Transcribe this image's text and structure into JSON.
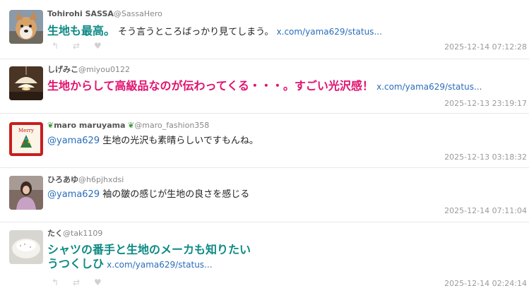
{
  "tweets": [
    {
      "name": "Tohirohi SASSA",
      "handle": "@SassaHero",
      "emph": "生地も最高。",
      "text": "そう言うところばっかり見てしまう。",
      "link": "x.com/yama629/status...",
      "time": "2025-12-14 07:12:28"
    },
    {
      "name": "しげみこ",
      "handle": "@miyou0122",
      "emph": "生地からして高級品なのが伝わってくる・・・。すごい光沢感！",
      "link": "x.com/yama629/status...",
      "time": "2025-12-13 23:19:17"
    },
    {
      "name": "maro maruyama",
      "handle": "@maro_fashion358",
      "mention": "@yama629",
      "text": "生地の光沢も素晴らしいですもんね。",
      "time": "2025-12-13 03:18:32"
    },
    {
      "name": "ひろあゆ",
      "handle": "@h6pjhxdsi",
      "mention": "@yama629",
      "text": "袖の皺の感じが生地の良さを感じる",
      "time": "2025-12-14 07:11:04"
    },
    {
      "name": "たく",
      "handle": "@tak1109",
      "emph": "シャツの番手と生地のメーカも知りたい",
      "emph2": "うつくしひ",
      "link": "x.com/yama629/status...",
      "time": "2025-12-14 02:24:14"
    }
  ],
  "actions": {
    "reply_icon": "↰",
    "retweet_icon": "⇄",
    "like_icon": "♥"
  },
  "icons": [
    "reply-icon",
    "retweet-icon",
    "like-icon",
    "leaf-icon"
  ],
  "colors": {
    "teal": "#0e8a84",
    "pink": "#e2126f",
    "link": "#2a6ebb"
  }
}
